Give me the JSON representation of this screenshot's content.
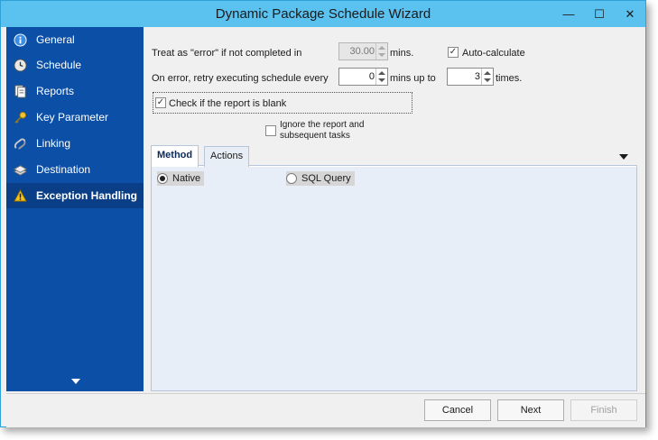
{
  "window": {
    "title": "Dynamic Package Schedule Wizard",
    "minimize_glyph": "—",
    "maximize_glyph": "☐",
    "close_glyph": "✕"
  },
  "sidebar": {
    "items": [
      {
        "label": "General",
        "icon": "info-icon"
      },
      {
        "label": "Schedule",
        "icon": "clock-icon"
      },
      {
        "label": "Reports",
        "icon": "reports-icon"
      },
      {
        "label": "Key Parameter",
        "icon": "key-icon"
      },
      {
        "label": "Linking",
        "icon": "link-icon"
      },
      {
        "label": "Destination",
        "icon": "destination-icon"
      },
      {
        "label": "Exception Handling",
        "icon": "warning-icon",
        "active": true
      }
    ]
  },
  "exception": {
    "treat_error_label": "Treat as \"error\" if not completed in",
    "timeout_value": "30.00",
    "mins_label": "mins.",
    "auto_calculate_label": "Auto-calculate",
    "auto_calculate_checked": true,
    "retry_label": "On error, retry  executing schedule every",
    "retry_every_value": "0",
    "mins_up_to_label": "mins up to",
    "retry_times_value": "3",
    "times_label": "times.",
    "check_blank_label": "Check if the report is blank",
    "check_blank_checked": true,
    "ignore_report_label_line1": "Ignore the report and",
    "ignore_report_label_line2": "subsequent tasks",
    "ignore_report_checked": false
  },
  "tabs": [
    {
      "label": "Method",
      "active": true
    },
    {
      "label": "Actions",
      "active": false
    }
  ],
  "method": {
    "options": [
      {
        "label": "Native",
        "selected": true
      },
      {
        "label": "SQL Query",
        "selected": false
      }
    ]
  },
  "footer": {
    "cancel_label": "Cancel",
    "next_label": "Next",
    "finish_label": "Finish"
  },
  "colors": {
    "titlebar": "#5bc1ef",
    "sidebar": "#0b4fa7",
    "sidebar_active": "#0a3f87"
  },
  "check_glyph": "✓"
}
